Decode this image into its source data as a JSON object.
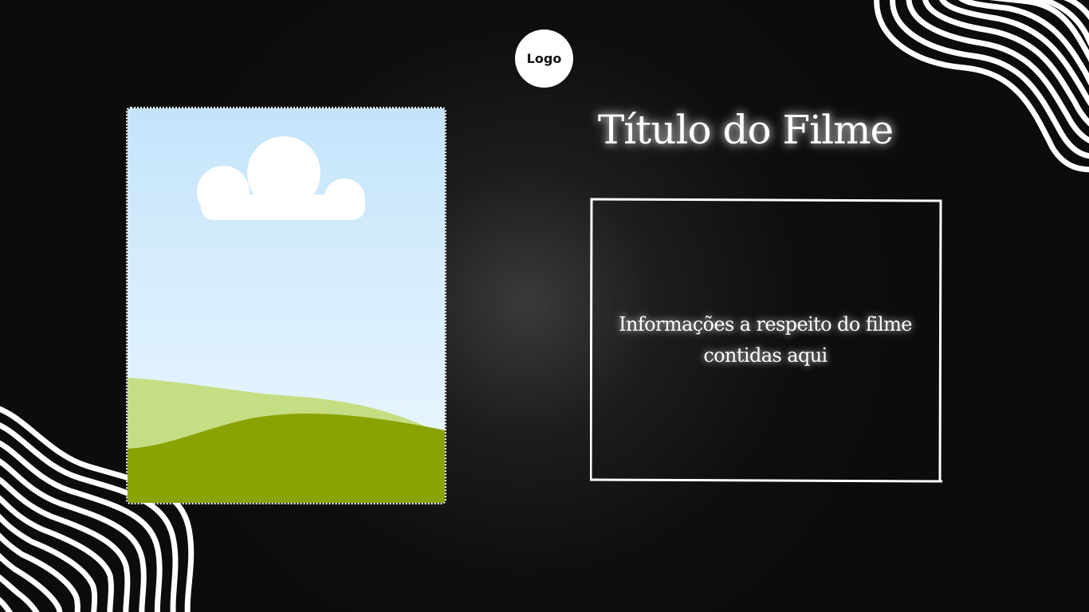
{
  "logo": {
    "label": "Logo"
  },
  "movie": {
    "title": "Título do Filme",
    "info": "Informações a respeito do filme contidas aqui"
  },
  "poster": {
    "icon": "image-placeholder-icon"
  },
  "decorations": {
    "pattern": "wavy-stripes"
  },
  "colors": {
    "background": "#0b0b0b",
    "text": "#ffffff",
    "sky_top": "#c4e4fb",
    "sky_bottom": "#eef8ff",
    "hill_light": "#c5de84",
    "hill_dark": "#8aa303"
  }
}
